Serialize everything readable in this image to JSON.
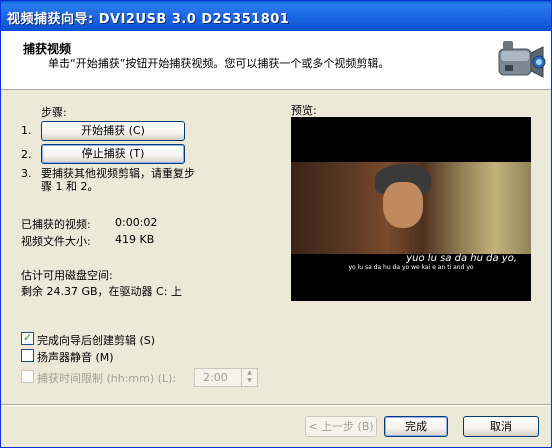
{
  "window": {
    "title": "视频捕获向导: DVI2USB 3.0 D2S351801"
  },
  "header": {
    "title": "捕获视频",
    "description": "单击“开始捕获”按钮开始捕获视频。您可以捕获一个或多个视频剪辑。",
    "icon": "camcorder-icon"
  },
  "steps": {
    "heading": "步骤:",
    "step1_num": "1.",
    "start_button": "开始捕获 (C)",
    "step2_num": "2.",
    "stop_button": "停止捕获 (T)",
    "step3_num": "3.",
    "step3_text": "要捕获其他视频剪辑，请重复步骤 1 和 2。"
  },
  "stats": {
    "captured_label": "已捕获的视频:",
    "captured_value": "0:00:02",
    "filesize_label": "视频文件大小:",
    "filesize_value": "419 KB",
    "disk_label": "估计可用磁盘空间:",
    "disk_value": "剩余 24.37 GB，在驱动器 C: 上"
  },
  "preview": {
    "label": "预览:",
    "subtitle_pinyin": "yuo lu sa da hu da yo,",
    "subtitle_small": "yo lu sa da hu da yo   we kai e an ti and yo"
  },
  "options": {
    "create_clips": {
      "label": "完成向导后创建剪辑 (S)",
      "checked": true
    },
    "mute_speaker": {
      "label": "扬声器静音 (M)",
      "checked": false
    },
    "time_limit": {
      "label": "捕获时间限制 (hh:mm) (L):",
      "checked": false,
      "enabled": false,
      "value": "2:00"
    }
  },
  "footer": {
    "back_button": "< 上一步 (B)",
    "finish_button": "完成",
    "cancel_button": "取消"
  }
}
